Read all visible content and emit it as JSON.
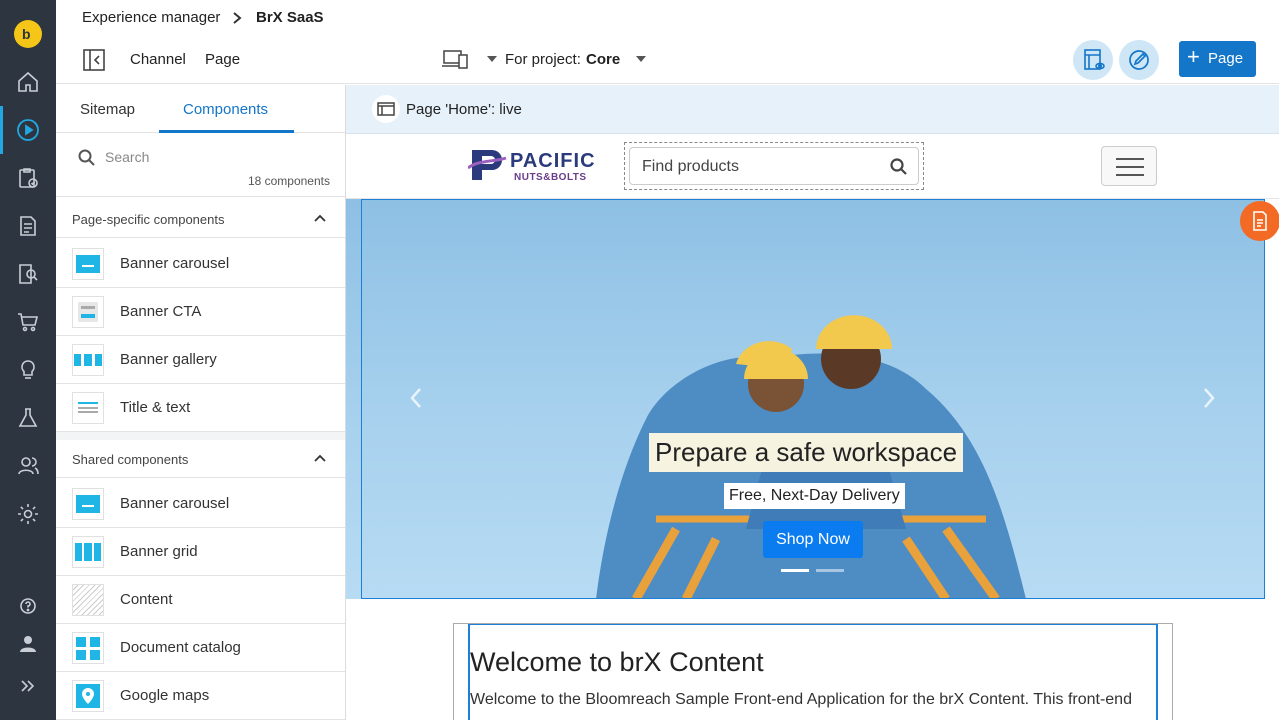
{
  "breadcrumb": {
    "root": "Experience manager",
    "current": "BrX SaaS"
  },
  "toolbar": {
    "channel_label": "Channel",
    "page_label": "Page",
    "project_label": "For project:",
    "project_value": "Core",
    "new_page_label": "Page"
  },
  "panel": {
    "tabs": {
      "sitemap": "Sitemap",
      "components": "Components"
    },
    "search_placeholder": "Search",
    "component_count": "18 components",
    "page_specific": {
      "title": "Page-specific components",
      "items": [
        "Banner carousel",
        "Banner CTA",
        "Banner gallery",
        "Title & text"
      ]
    },
    "shared": {
      "title": "Shared components",
      "items": [
        "Banner carousel",
        "Banner grid",
        "Content",
        "Document catalog",
        "Google maps"
      ]
    }
  },
  "preview": {
    "page_status": "Page 'Home': live",
    "brand_line1": "PACIFIC",
    "brand_line2": "NUTS&BOLTS",
    "site_search_placeholder": "Find products",
    "hero": {
      "title": "Prepare a safe workspace",
      "subtitle": "Free, Next-Day Delivery",
      "cta": "Shop Now"
    },
    "content": {
      "heading": "Welcome to brX Content",
      "body": "Welcome to the Bloomreach Sample Front-end Application for the brX Content. This front-end"
    }
  },
  "colors": {
    "rail": "#2d3540",
    "accent": "#1376c9",
    "logo": "#f5c518",
    "edit_badge": "#f26a24"
  }
}
